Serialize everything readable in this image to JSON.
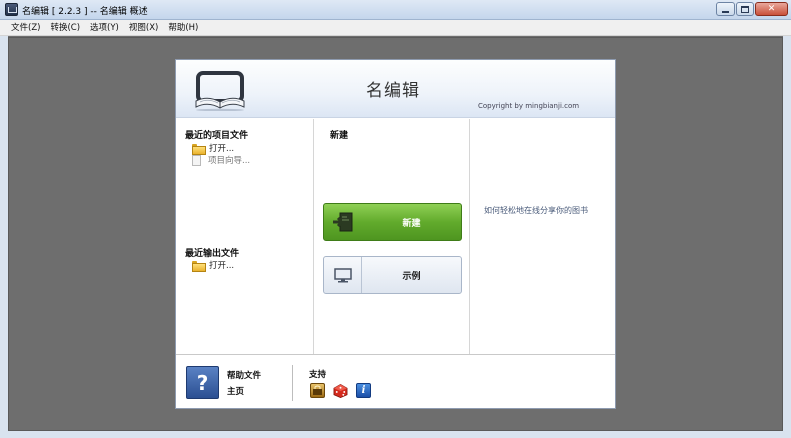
{
  "window": {
    "title": "名编辑 [ 2.2.3 ] -- 名编辑 概述",
    "close_glyph": "✕"
  },
  "menu": [
    {
      "label": "文件(Z)"
    },
    {
      "label": "转换(C)"
    },
    {
      "label": "选项(Y)"
    },
    {
      "label": "视图(X)"
    },
    {
      "label": "帮助(H)"
    }
  ],
  "header": {
    "app_name": "名编辑",
    "copyright": "Copyright by mingbianji.com"
  },
  "recent_projects": {
    "title": "最近的项目文件",
    "open_label": "打开...",
    "wizard_label": "项目向导..."
  },
  "recent_outputs": {
    "title": "最近输出文件",
    "open_label": "打开..."
  },
  "new_section": {
    "title": "新建",
    "new_button": "新建",
    "sample_button": "示例"
  },
  "right_panel": {
    "tip": "如何轻松地在线分享你的图书"
  },
  "footer": {
    "help_icon": "?",
    "help_title": "帮助文件",
    "home_label": "主页",
    "support_title": "支持",
    "info_glyph": "i"
  },
  "colors": {
    "new_button": "#62ab2c",
    "workspace": "#6e6e6e",
    "accent_blue": "#2b4f92"
  },
  "icons": [
    "app-icon",
    "minimize-icon",
    "maximize-icon",
    "close-icon",
    "book-logo-icon",
    "folder-icon",
    "document-icon",
    "new-project-icon",
    "monitor-icon",
    "help-icon",
    "shop-icon",
    "dice-icon",
    "info-icon"
  ]
}
